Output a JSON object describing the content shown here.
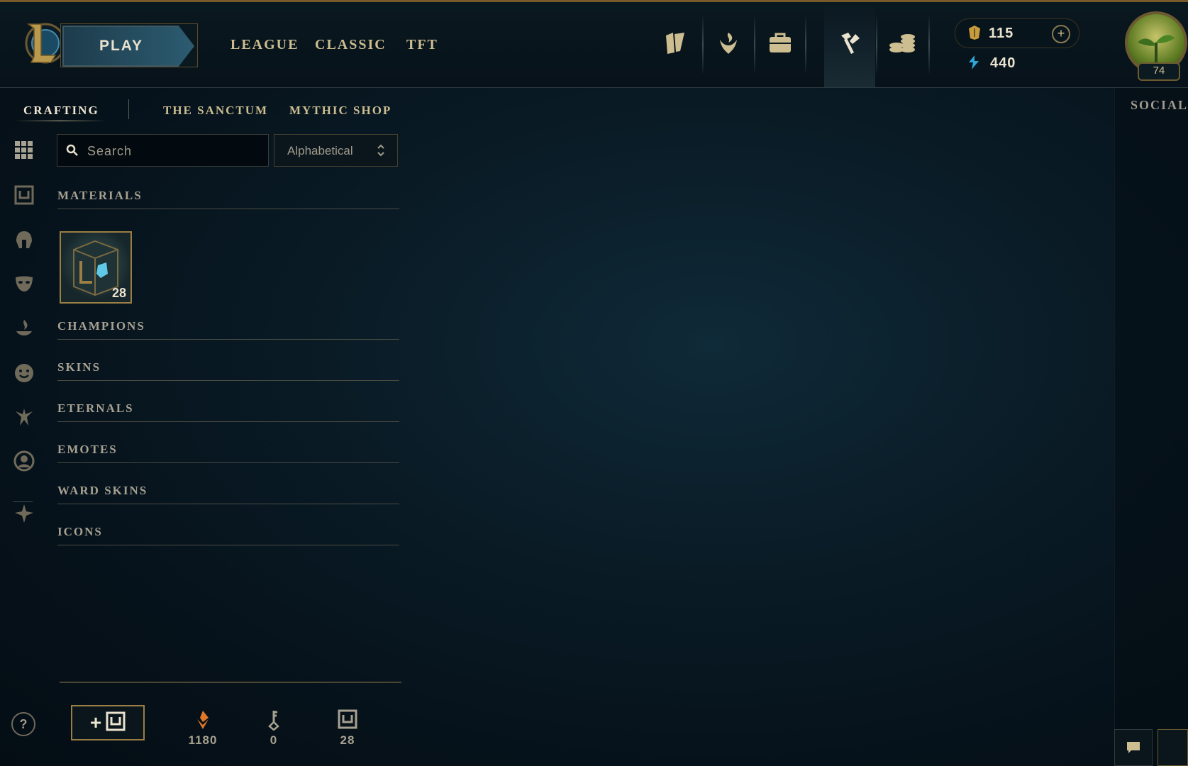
{
  "header": {
    "play_label": "PLAY",
    "nav": [
      "LEAGUE",
      "CLASSIC",
      "TFT"
    ],
    "icons": [
      "collection-icon",
      "ranked-emblem-icon",
      "store-bag-icon",
      "crafting-hammer-icon",
      "coins-icon"
    ],
    "active_icon": "crafting-hammer-icon",
    "currency": {
      "rp": "115",
      "blue_essence": "440",
      "add_label": "+"
    },
    "profile": {
      "level": "74"
    }
  },
  "social": {
    "label": "SOCIAL"
  },
  "subnav": {
    "items": [
      "CRAFTING",
      "THE SANCTUM",
      "MYTHIC SHOP"
    ],
    "active": "CRAFTING"
  },
  "rail": {
    "icons": [
      "grid-icon",
      "chest-icon",
      "helmet-icon",
      "mask-icon",
      "flame-icon",
      "smiley-icon",
      "eternal-icon",
      "profile-icon",
      "ward-icon"
    ]
  },
  "search": {
    "placeholder": "Search",
    "value": ""
  },
  "sort": {
    "selected": "Alphabetical"
  },
  "categories": {
    "materials": "MATERIALS",
    "champions": "CHAMPIONS",
    "skins": "SKINS",
    "eternals": "ETERNALS",
    "emotes": "EMOTES",
    "ward_skins": "WARD SKINS",
    "icons": "ICONS"
  },
  "materials": [
    {
      "name": "Hextech Chest",
      "count": "28"
    }
  ],
  "bottom": {
    "help_label": "?",
    "craft_add_label": "+",
    "resources": [
      {
        "icon": "orange-essence-icon",
        "value": "1180"
      },
      {
        "icon": "key-icon",
        "value": "0"
      },
      {
        "icon": "chest-icon",
        "value": "28"
      }
    ]
  },
  "colors": {
    "gold": "#cdbe91",
    "accent_gold": "#9a7e44",
    "background": "#0a1c27"
  }
}
